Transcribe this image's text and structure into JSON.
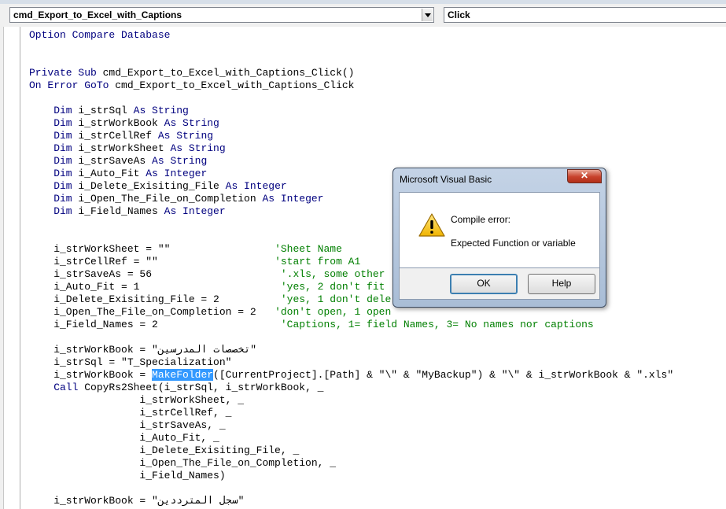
{
  "header": {
    "object_combo": "cmd_Export_to_Excel_with_Captions",
    "procedure_combo": "Click"
  },
  "code": {
    "lines": [
      [
        {
          "t": "Option Compare Database",
          "c": "kw"
        }
      ],
      [],
      [],
      [
        {
          "t": "Private Sub ",
          "c": "kw"
        },
        {
          "t": "cmd_Export_to_Excel_with_Captions_Click()"
        }
      ],
      [
        {
          "t": "On Error GoTo ",
          "c": "kw"
        },
        {
          "t": "cmd_Export_to_Excel_with_Captions_Click"
        }
      ],
      [],
      [
        {
          "t": "    Dim ",
          "c": "kw"
        },
        {
          "t": "i_strSql "
        },
        {
          "t": "As String",
          "c": "kw"
        }
      ],
      [
        {
          "t": "    Dim ",
          "c": "kw"
        },
        {
          "t": "i_strWorkBook "
        },
        {
          "t": "As String",
          "c": "kw"
        }
      ],
      [
        {
          "t": "    Dim ",
          "c": "kw"
        },
        {
          "t": "i_strCellRef "
        },
        {
          "t": "As String",
          "c": "kw"
        }
      ],
      [
        {
          "t": "    Dim ",
          "c": "kw"
        },
        {
          "t": "i_strWorkSheet "
        },
        {
          "t": "As String",
          "c": "kw"
        }
      ],
      [
        {
          "t": "    Dim ",
          "c": "kw"
        },
        {
          "t": "i_strSaveAs "
        },
        {
          "t": "As String",
          "c": "kw"
        }
      ],
      [
        {
          "t": "    Dim ",
          "c": "kw"
        },
        {
          "t": "i_Auto_Fit "
        },
        {
          "t": "As Integer",
          "c": "kw"
        }
      ],
      [
        {
          "t": "    Dim ",
          "c": "kw"
        },
        {
          "t": "i_Delete_Exisiting_File "
        },
        {
          "t": "As Integer",
          "c": "kw"
        }
      ],
      [
        {
          "t": "    Dim ",
          "c": "kw"
        },
        {
          "t": "i_Open_The_File_on_Completion "
        },
        {
          "t": "As Integer",
          "c": "kw"
        }
      ],
      [
        {
          "t": "    Dim ",
          "c": "kw"
        },
        {
          "t": "i_Field_Names "
        },
        {
          "t": "As Integer",
          "c": "kw"
        }
      ],
      [],
      [],
      [
        {
          "t": "    i_strWorkSheet = \"\"                 "
        },
        {
          "t": "'Sheet Name",
          "c": "cm"
        }
      ],
      [
        {
          "t": "    i_strCellRef = \"\"                   "
        },
        {
          "t": "'start from A1",
          "c": "cm"
        }
      ],
      [
        {
          "t": "    i_strSaveAs = 56                     "
        },
        {
          "t": "'.xls, some other",
          "c": "cm"
        }
      ],
      [
        {
          "t": "    i_Auto_Fit = 1                       "
        },
        {
          "t": "'yes, 2 don't fit",
          "c": "cm"
        }
      ],
      [
        {
          "t": "    i_Delete_Exisiting_File = 2          "
        },
        {
          "t": "'yes, 1 don't dele",
          "c": "cm"
        }
      ],
      [
        {
          "t": "    i_Open_The_File_on_Completion = 2   "
        },
        {
          "t": "'don't open, 1 open",
          "c": "cm"
        }
      ],
      [
        {
          "t": "    i_Field_Names = 2                    "
        },
        {
          "t": "'Captions, 1= field Names, 3= No names nor captions",
          "c": "cm"
        }
      ],
      [],
      [
        {
          "t": "    i_strWorkBook = \"تخصصات المدرسين\""
        }
      ],
      [
        {
          "t": "    i_strSql = \"T_Specialization\""
        }
      ],
      [
        {
          "t": "    i_strWorkBook = "
        },
        {
          "t": "MakeFolder",
          "c": "sel"
        },
        {
          "t": "([CurrentProject].[Path] & \"\\\" & \"MyBackup\") & \"\\\" & i_strWorkBook & \".xls\""
        }
      ],
      [
        {
          "t": "    Call ",
          "c": "kw"
        },
        {
          "t": "CopyRs2Sheet(i_strSql, i_strWorkBook, _"
        }
      ],
      [
        {
          "t": "                  i_strWorkSheet, _"
        }
      ],
      [
        {
          "t": "                  i_strCellRef, _"
        }
      ],
      [
        {
          "t": "                  i_strSaveAs, _"
        }
      ],
      [
        {
          "t": "                  i_Auto_Fit, _"
        }
      ],
      [
        {
          "t": "                  i_Delete_Exisiting_File, _"
        }
      ],
      [
        {
          "t": "                  i_Open_The_File_on_Completion, _"
        }
      ],
      [
        {
          "t": "                  i_Field_Names)"
        }
      ],
      [],
      [
        {
          "t": "    i_strWorkBook = \"سجل المترددين\""
        }
      ]
    ]
  },
  "dialog": {
    "title": "Microsoft Visual Basic",
    "close_symbol": "✕",
    "icon": "warning-icon",
    "message_heading": "Compile error:",
    "message_detail": "Expected Function or variable",
    "ok_label": "OK",
    "help_label": "Help"
  },
  "colors": {
    "keyword": "#00007f",
    "comment": "#007f00",
    "selection": "#3399ff"
  }
}
